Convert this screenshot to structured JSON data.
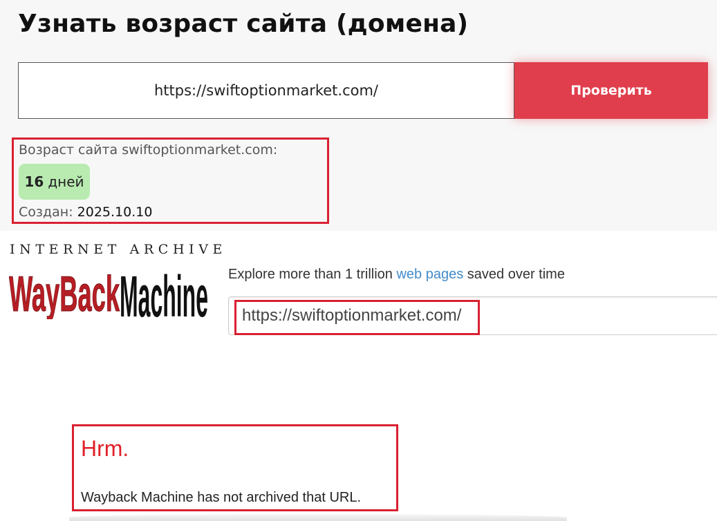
{
  "checker": {
    "title": "Узнать возраст сайта (домена)",
    "url_value": "https://swiftoptionmarket.com/",
    "check_button": "Проверить",
    "result": {
      "age_label": "Возраст сайта swiftoptionmarket.com:",
      "age_number": "16",
      "age_unit": "дней",
      "created_label": "Создан:",
      "created_date": "2025.10.10"
    }
  },
  "wayback": {
    "internet_archive": "INTERNET ARCHIVE",
    "logo_wayback": "WayBack",
    "logo_machine": "Machine",
    "explore_prefix": "Explore more than 1 trillion",
    "explore_link": "web pages",
    "explore_suffix": "saved over time",
    "url_value": "https://swiftoptionmarket.com/",
    "error_title": "Hrm.",
    "error_message": "Wayback Machine has not archived that URL.",
    "colors": {
      "logo_red": "#b51e24",
      "link": "#428bca",
      "error_red": "#e0202a"
    }
  },
  "colors": {
    "button": "#e03e4d",
    "badge": "#b9ebb1",
    "highlight": "#d92030"
  }
}
